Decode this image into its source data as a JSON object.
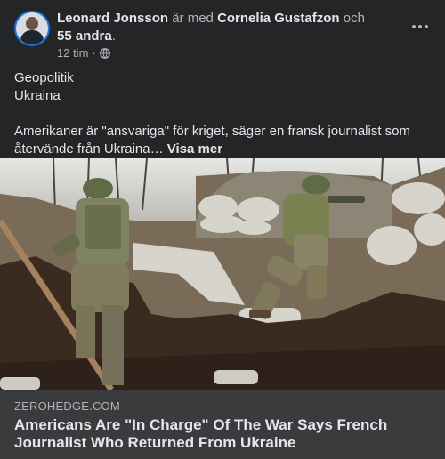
{
  "post": {
    "author": "Leonard Jonsson",
    "with_text": " är med ",
    "tagged": "Cornelia Gustafzon",
    "and_text": " och",
    "others": "55 andra",
    "period": ".",
    "time": "12 tim",
    "separator": "·",
    "privacy_icon": "globe-icon",
    "more_icon": "more-options-icon",
    "lines": [
      "Geopolitik",
      "Ukraina"
    ],
    "body": "Amerikaner är \"ansvariga\" för kriget, säger en fransk journalist som återvände från Ukraina… ",
    "see_more": "Visa mer"
  },
  "link": {
    "domain": "ZEROHEDGE.COM",
    "title": "Americans Are \"In Charge\" Of The War Says French Journalist Who Returned From Ukraine"
  },
  "colors": {
    "background": "#242526",
    "link_footer": "#3a3b3c",
    "primary_text": "#e4e6eb",
    "secondary_text": "#b0b3b8",
    "avatar_ring": "#1b74e4"
  }
}
